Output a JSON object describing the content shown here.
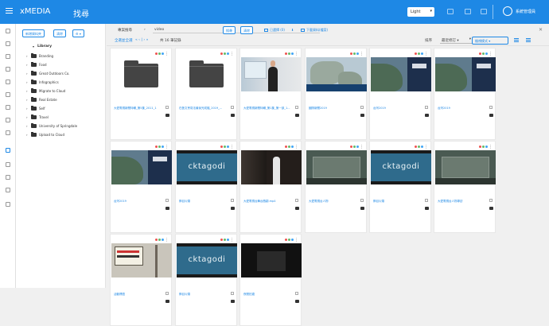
{
  "header": {
    "app_name": "xMEDIA",
    "page_title": "找尋",
    "theme_label": "Light",
    "user_name": "系統管理員"
  },
  "tree": {
    "new_folder_label": "新增資料夾",
    "clear_label": "清除",
    "settings_label": "⚙ ▾",
    "library_label": "Library",
    "items": [
      {
        "label": "Branding"
      },
      {
        "label": "Food"
      },
      {
        "label": "Great Outdoors Co."
      },
      {
        "label": "Infographics"
      },
      {
        "label": "Migrate to Cloud"
      },
      {
        "label": "Real Estate"
      },
      {
        "label": "Self"
      },
      {
        "label": "Travel"
      },
      {
        "label": "University of Springdale"
      },
      {
        "label": "Upload to Cloud"
      }
    ]
  },
  "toolbar": {
    "breadcrumb_root": "專案搜尋",
    "breadcrumb_sep": "›",
    "path_value": "video",
    "search_label": "搜尋",
    "reset_label": "清除",
    "collect_label": "已選擇 (0)",
    "download_label": "下載資料(檔案)",
    "close_label": "✕"
  },
  "subbar": {
    "select_all": "全選並全選",
    "pager": "« ‹ | › »",
    "count": "共 16 筆記錄",
    "sort_label": "排序",
    "sort_value": "最近修訂 ▾",
    "view_label": "檢視模式 ▾"
  },
  "cards": [
    {
      "type": "folder",
      "name": "大愛電視新聞特輯_第5集_2011_1"
    },
    {
      "type": "folder",
      "name": "在藝文會寫法最後完成檔_2019_..."
    },
    {
      "type": "news",
      "name": "大愛電視新聞特輯_第1集_第一部_1..."
    },
    {
      "type": "map",
      "name": "國際新聞2019"
    },
    {
      "type": "earth",
      "name": "台灣2019"
    },
    {
      "type": "earth",
      "name": "台灣2019"
    },
    {
      "type": "earth",
      "name": "台灣2019"
    },
    {
      "type": "logo",
      "name": "節目片頭"
    },
    {
      "type": "stage",
      "name": "大愛電視台舞台戲劇.mp4"
    },
    {
      "type": "tunnel",
      "name": "大愛電視台人物"
    },
    {
      "type": "logo",
      "name": "節目片頭"
    },
    {
      "type": "tunnel",
      "name": "大愛電視台人物專訪"
    },
    {
      "type": "sign",
      "name": "活動標語"
    },
    {
      "type": "logo",
      "name": "節目片頭"
    },
    {
      "type": "dark",
      "name": "夜間拍攝"
    }
  ],
  "logo_text": "cktagodi",
  "colors": {
    "brand": "#1e88e5",
    "dot_red": "#ef5350",
    "dot_green": "#66bb6a",
    "dot_blue": "#42a5f5"
  }
}
